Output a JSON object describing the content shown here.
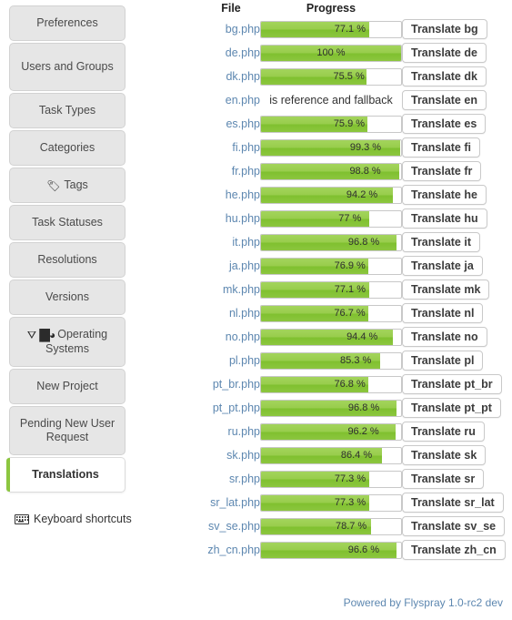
{
  "sidebar": {
    "items": [
      {
        "label": "Preferences",
        "icon": null,
        "active": false,
        "two_line": false
      },
      {
        "label": "Users and Groups",
        "icon": null,
        "active": false,
        "two_line": true
      },
      {
        "label": "Task Types",
        "icon": null,
        "active": false,
        "two_line": false
      },
      {
        "label": "Categories",
        "icon": null,
        "active": false,
        "two_line": false
      },
      {
        "label": "Tags",
        "icon": "tag-icon",
        "active": false,
        "two_line": false
      },
      {
        "label": "Task Statuses",
        "icon": null,
        "active": false,
        "two_line": false
      },
      {
        "label": "Resolutions",
        "icon": null,
        "active": false,
        "two_line": false
      },
      {
        "label": "Versions",
        "icon": null,
        "active": false,
        "two_line": false
      },
      {
        "label": "Operating Systems",
        "icon": "os-icons",
        "active": false,
        "two_line": true
      },
      {
        "label": "New Project",
        "icon": null,
        "active": false,
        "two_line": false
      },
      {
        "label": "Pending New User Request",
        "icon": null,
        "active": false,
        "two_line": true
      },
      {
        "label": "Translations",
        "icon": null,
        "active": true,
        "two_line": false
      }
    ],
    "shortcuts_label": "Keyboard shortcuts",
    "shortcuts_icon": "keyboard-icon",
    "active_accent_color": "#8cc63f"
  },
  "table": {
    "headers": {
      "file": "File",
      "progress": "Progress",
      "action": ""
    },
    "rows": [
      {
        "file": "bg.php",
        "percent": 77.1,
        "progress_text": "77.1 %",
        "button": "Translate bg",
        "reference": false
      },
      {
        "file": "de.php",
        "percent": 100,
        "progress_text": "100 %",
        "button": "Translate de",
        "reference": false
      },
      {
        "file": "dk.php",
        "percent": 75.5,
        "progress_text": "75.5 %",
        "button": "Translate dk",
        "reference": false
      },
      {
        "file": "en.php",
        "percent": null,
        "progress_text": "is reference and fallback",
        "button": "Translate en",
        "reference": true
      },
      {
        "file": "es.php",
        "percent": 75.9,
        "progress_text": "75.9 %",
        "button": "Translate es",
        "reference": false
      },
      {
        "file": "fi.php",
        "percent": 99.3,
        "progress_text": "99.3 %",
        "button": "Translate fi",
        "reference": false
      },
      {
        "file": "fr.php",
        "percent": 98.8,
        "progress_text": "98.8 %",
        "button": "Translate fr",
        "reference": false
      },
      {
        "file": "he.php",
        "percent": 94.2,
        "progress_text": "94.2 %",
        "button": "Translate he",
        "reference": false
      },
      {
        "file": "hu.php",
        "percent": 77,
        "progress_text": "77 %",
        "button": "Translate hu",
        "reference": false
      },
      {
        "file": "it.php",
        "percent": 96.8,
        "progress_text": "96.8 %",
        "button": "Translate it",
        "reference": false
      },
      {
        "file": "ja.php",
        "percent": 76.9,
        "progress_text": "76.9 %",
        "button": "Translate ja",
        "reference": false
      },
      {
        "file": "mk.php",
        "percent": 77.1,
        "progress_text": "77.1 %",
        "button": "Translate mk",
        "reference": false
      },
      {
        "file": "nl.php",
        "percent": 76.7,
        "progress_text": "76.7 %",
        "button": "Translate nl",
        "reference": false
      },
      {
        "file": "no.php",
        "percent": 94.4,
        "progress_text": "94.4 %",
        "button": "Translate no",
        "reference": false
      },
      {
        "file": "pl.php",
        "percent": 85.3,
        "progress_text": "85.3 %",
        "button": "Translate pl",
        "reference": false
      },
      {
        "file": "pt_br.php",
        "percent": 76.8,
        "progress_text": "76.8 %",
        "button": "Translate pt_br",
        "reference": false
      },
      {
        "file": "pt_pt.php",
        "percent": 96.8,
        "progress_text": "96.8 %",
        "button": "Translate pt_pt",
        "reference": false
      },
      {
        "file": "ru.php",
        "percent": 96.2,
        "progress_text": "96.2 %",
        "button": "Translate ru",
        "reference": false
      },
      {
        "file": "sk.php",
        "percent": 86.4,
        "progress_text": "86.4 %",
        "button": "Translate sk",
        "reference": false
      },
      {
        "file": "sr.php",
        "percent": 77.3,
        "progress_text": "77.3 %",
        "button": "Translate sr",
        "reference": false
      },
      {
        "file": "sr_lat.php",
        "percent": 77.3,
        "progress_text": "77.3 %",
        "button": "Translate sr_lat",
        "reference": false
      },
      {
        "file": "sv_se.php",
        "percent": 78.7,
        "progress_text": "78.7 %",
        "button": "Translate sv_se",
        "reference": false
      },
      {
        "file": "zh_cn.php",
        "percent": 96.6,
        "progress_text": "96.6 %",
        "button": "Translate zh_cn",
        "reference": false
      }
    ],
    "bar_color": "#8cc63f",
    "link_color": "#5d87b0"
  },
  "footer": {
    "text": "Powered by Flyspray 1.0-rc2 dev"
  }
}
